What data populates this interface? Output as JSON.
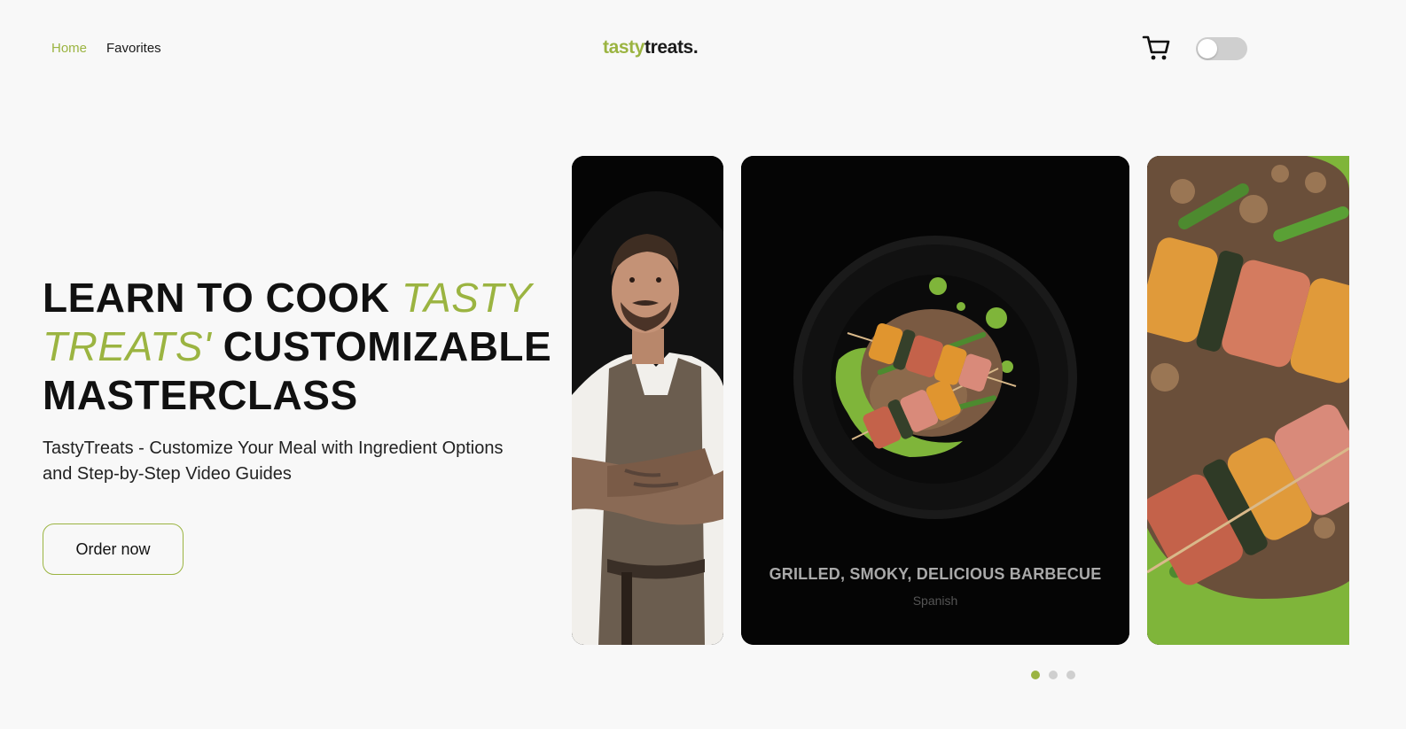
{
  "nav": {
    "home": "Home",
    "favorites": "Favorites"
  },
  "logo": {
    "part1": "tasty",
    "part2": "treats."
  },
  "header": {
    "cart_icon": "shopping-cart-icon",
    "theme_toggle_state": "off"
  },
  "hero": {
    "title_part1": "LEARN TO COOK ",
    "title_accent": "TASTY TREATS'",
    "title_part2": " CUSTOMIZABLE MASTERCLASS",
    "subtitle": "TastyTreats - Customize Your Meal with Ingredient Options and Step-by-Step Video Guides",
    "cta": "Order now"
  },
  "carousel": {
    "cards": [
      {
        "kind": "chef-photo"
      },
      {
        "kind": "dish-photo",
        "title": "GRILLED, SMOKY, DELICIOUS BARBECUE",
        "cuisine": "Spanish"
      },
      {
        "kind": "dish-closeup"
      }
    ],
    "dots": 3,
    "active_dot": 0
  },
  "colors": {
    "accent": "#9bb441",
    "background": "#f8f8f8",
    "text": "#111111"
  }
}
